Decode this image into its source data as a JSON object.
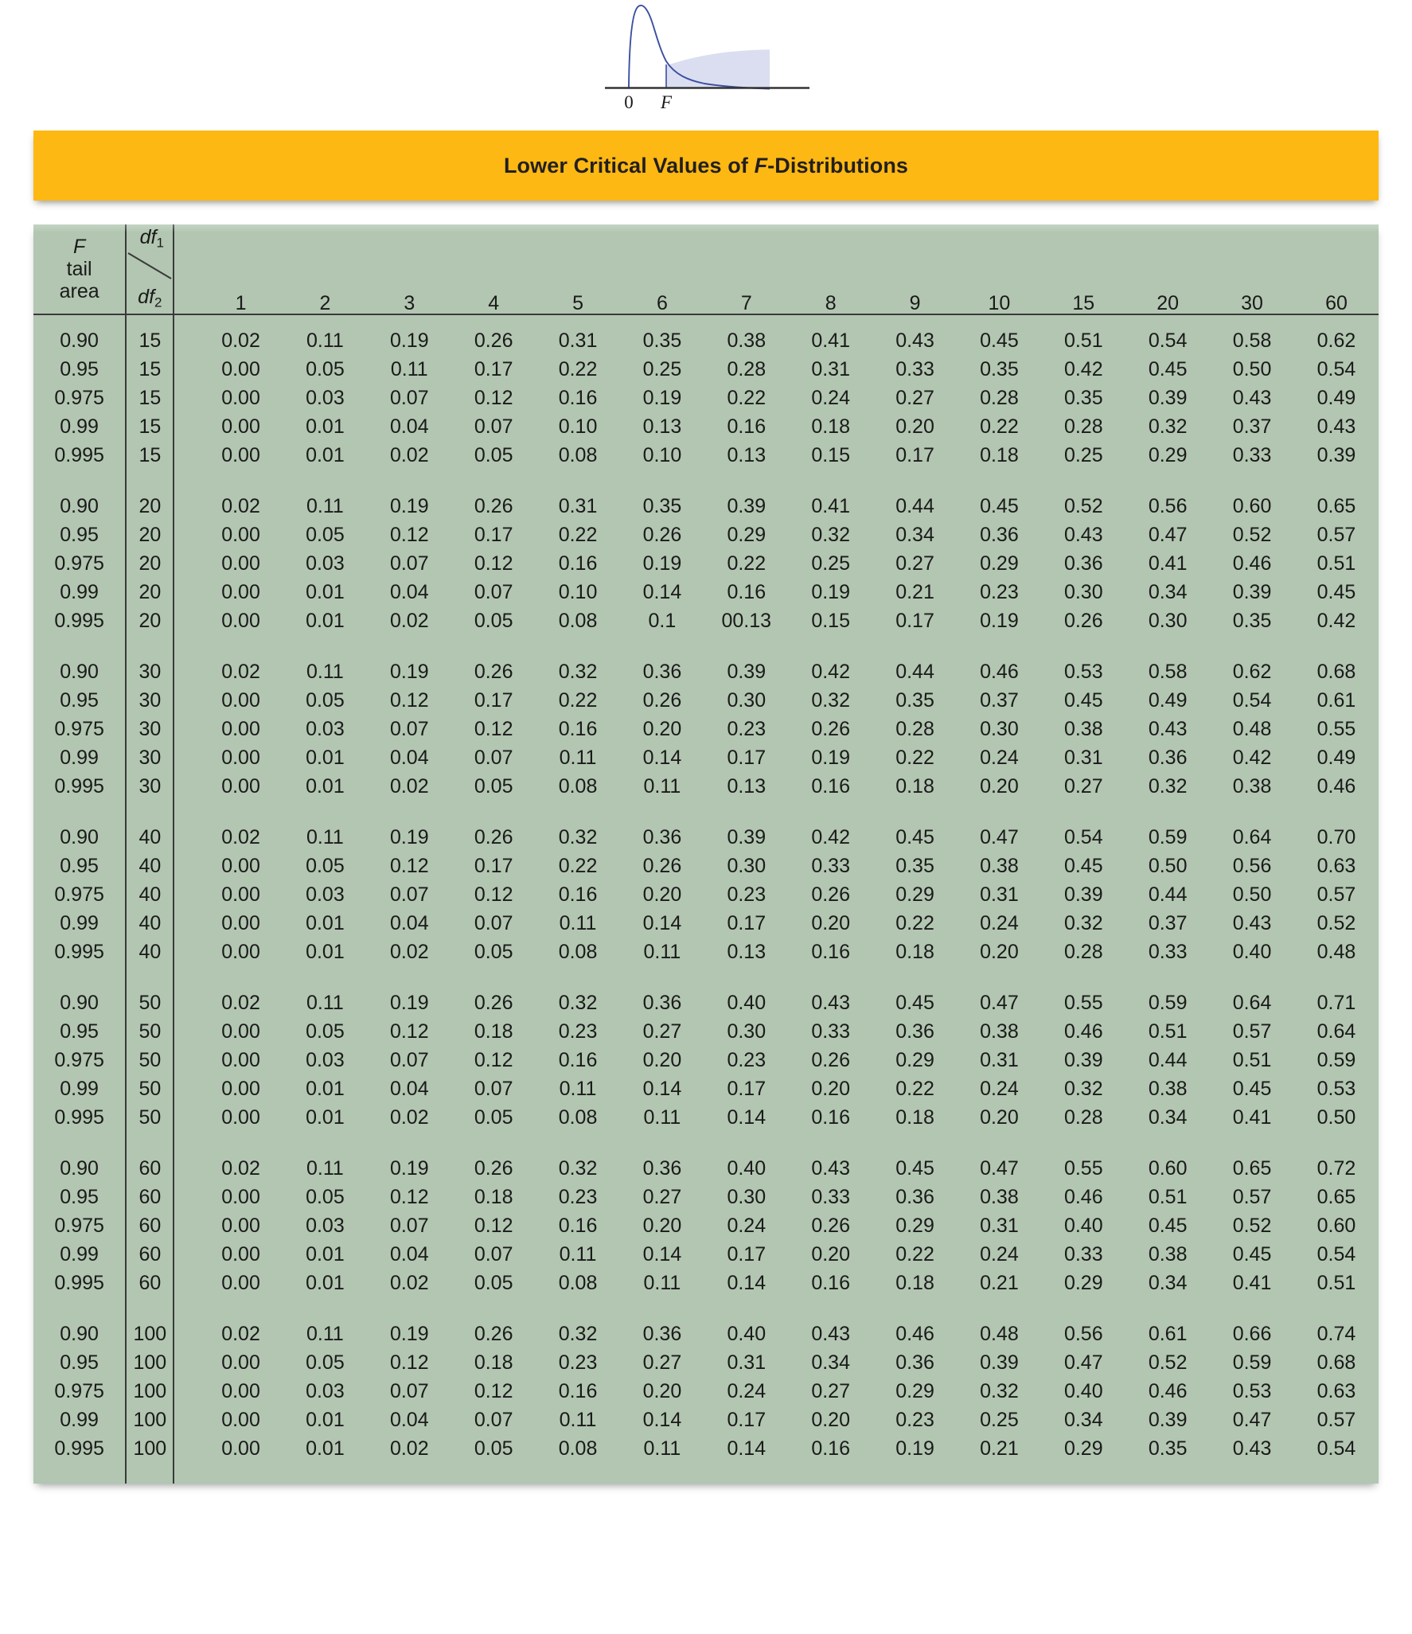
{
  "figure": {
    "axis_label_zero": "0",
    "axis_label_f": "F",
    "curve_color": "#3b4ea0",
    "shade_color": "#d9dcef",
    "axis_color": "#333333",
    "description": "F-distribution density curve with right tail shaded beyond F"
  },
  "title": {
    "prefix": "Lower Critical Values of ",
    "italic": "F",
    "suffix": "-Distributions",
    "full": "Lower Critical Values of F-Distributions",
    "banner_color": "#fdb813"
  },
  "table": {
    "background_color": "#b2c6b1",
    "corner": {
      "tail_label_line1": "F",
      "tail_label_line2": "tail",
      "tail_label_line3": "area",
      "df1": "df",
      "df1_sub": "1",
      "df2": "df",
      "df2_sub": "2"
    },
    "columns": [
      "1",
      "2",
      "3",
      "4",
      "5",
      "6",
      "7",
      "8",
      "9",
      "10",
      "15",
      "20",
      "30",
      "60"
    ],
    "blocks": [
      {
        "df2": "15",
        "rows": [
          {
            "tail": "0.90",
            "df2": "15",
            "values": [
              "0.02",
              "0.11",
              "0.19",
              "0.26",
              "0.31",
              "0.35",
              "0.38",
              "0.41",
              "0.43",
              "0.45",
              "0.51",
              "0.54",
              "0.58",
              "0.62"
            ]
          },
          {
            "tail": "0.95",
            "df2": "15",
            "values": [
              "0.00",
              "0.05",
              "0.11",
              "0.17",
              "0.22",
              "0.25",
              "0.28",
              "0.31",
              "0.33",
              "0.35",
              "0.42",
              "0.45",
              "0.50",
              "0.54"
            ]
          },
          {
            "tail": "0.975",
            "df2": "15",
            "values": [
              "0.00",
              "0.03",
              "0.07",
              "0.12",
              "0.16",
              "0.19",
              "0.22",
              "0.24",
              "0.27",
              "0.28",
              "0.35",
              "0.39",
              "0.43",
              "0.49"
            ]
          },
          {
            "tail": "0.99",
            "df2": "15",
            "values": [
              "0.00",
              "0.01",
              "0.04",
              "0.07",
              "0.10",
              "0.13",
              "0.16",
              "0.18",
              "0.20",
              "0.22",
              "0.28",
              "0.32",
              "0.37",
              "0.43"
            ]
          },
          {
            "tail": "0.995",
            "df2": "15",
            "values": [
              "0.00",
              "0.01",
              "0.02",
              "0.05",
              "0.08",
              "0.10",
              "0.13",
              "0.15",
              "0.17",
              "0.18",
              "0.25",
              "0.29",
              "0.33",
              "0.39"
            ]
          }
        ]
      },
      {
        "df2": "20",
        "rows": [
          {
            "tail": "0.90",
            "df2": "20",
            "values": [
              "0.02",
              "0.11",
              "0.19",
              "0.26",
              "0.31",
              "0.35",
              "0.39",
              "0.41",
              "0.44",
              "0.45",
              "0.52",
              "0.56",
              "0.60",
              "0.65"
            ]
          },
          {
            "tail": "0.95",
            "df2": "20",
            "values": [
              "0.00",
              "0.05",
              "0.12",
              "0.17",
              "0.22",
              "0.26",
              "0.29",
              "0.32",
              "0.34",
              "0.36",
              "0.43",
              "0.47",
              "0.52",
              "0.57"
            ]
          },
          {
            "tail": "0.975",
            "df2": "20",
            "values": [
              "0.00",
              "0.03",
              "0.07",
              "0.12",
              "0.16",
              "0.19",
              "0.22",
              "0.25",
              "0.27",
              "0.29",
              "0.36",
              "0.41",
              "0.46",
              "0.51"
            ]
          },
          {
            "tail": "0.99",
            "df2": "20",
            "values": [
              "0.00",
              "0.01",
              "0.04",
              "0.07",
              "0.10",
              "0.14",
              "0.16",
              "0.19",
              "0.21",
              "0.23",
              "0.30",
              "0.34",
              "0.39",
              "0.45"
            ]
          },
          {
            "tail": "0.995",
            "df2": "20",
            "values": [
              "0.00",
              "0.01",
              "0.02",
              "0.05",
              "0.08",
              "0.1",
              "00.13",
              "0.15",
              "0.17",
              "0.19",
              "0.26",
              "0.30",
              "0.35",
              "0.42"
            ]
          }
        ]
      },
      {
        "df2": "30",
        "rows": [
          {
            "tail": "0.90",
            "df2": "30",
            "values": [
              "0.02",
              "0.11",
              "0.19",
              "0.26",
              "0.32",
              "0.36",
              "0.39",
              "0.42",
              "0.44",
              "0.46",
              "0.53",
              "0.58",
              "0.62",
              "0.68"
            ]
          },
          {
            "tail": "0.95",
            "df2": "30",
            "values": [
              "0.00",
              "0.05",
              "0.12",
              "0.17",
              "0.22",
              "0.26",
              "0.30",
              "0.32",
              "0.35",
              "0.37",
              "0.45",
              "0.49",
              "0.54",
              "0.61"
            ]
          },
          {
            "tail": "0.975",
            "df2": "30",
            "values": [
              "0.00",
              "0.03",
              "0.07",
              "0.12",
              "0.16",
              "0.20",
              "0.23",
              "0.26",
              "0.28",
              "0.30",
              "0.38",
              "0.43",
              "0.48",
              "0.55"
            ]
          },
          {
            "tail": "0.99",
            "df2": "30",
            "values": [
              "0.00",
              "0.01",
              "0.04",
              "0.07",
              "0.11",
              "0.14",
              "0.17",
              "0.19",
              "0.22",
              "0.24",
              "0.31",
              "0.36",
              "0.42",
              "0.49"
            ]
          },
          {
            "tail": "0.995",
            "df2": "30",
            "values": [
              "0.00",
              "0.01",
              "0.02",
              "0.05",
              "0.08",
              "0.11",
              "0.13",
              "0.16",
              "0.18",
              "0.20",
              "0.27",
              "0.32",
              "0.38",
              "0.46"
            ]
          }
        ]
      },
      {
        "df2": "40",
        "rows": [
          {
            "tail": "0.90",
            "df2": "40",
            "values": [
              "0.02",
              "0.11",
              "0.19",
              "0.26",
              "0.32",
              "0.36",
              "0.39",
              "0.42",
              "0.45",
              "0.47",
              "0.54",
              "0.59",
              "0.64",
              "0.70"
            ]
          },
          {
            "tail": "0.95",
            "df2": "40",
            "values": [
              "0.00",
              "0.05",
              "0.12",
              "0.17",
              "0.22",
              "0.26",
              "0.30",
              "0.33",
              "0.35",
              "0.38",
              "0.45",
              "0.50",
              "0.56",
              "0.63"
            ]
          },
          {
            "tail": "0.975",
            "df2": "40",
            "values": [
              "0.00",
              "0.03",
              "0.07",
              "0.12",
              "0.16",
              "0.20",
              "0.23",
              "0.26",
              "0.29",
              "0.31",
              "0.39",
              "0.44",
              "0.50",
              "0.57"
            ]
          },
          {
            "tail": "0.99",
            "df2": "40",
            "values": [
              "0.00",
              "0.01",
              "0.04",
              "0.07",
              "0.11",
              "0.14",
              "0.17",
              "0.20",
              "0.22",
              "0.24",
              "0.32",
              "0.37",
              "0.43",
              "0.52"
            ]
          },
          {
            "tail": "0.995",
            "df2": "40",
            "values": [
              "0.00",
              "0.01",
              "0.02",
              "0.05",
              "0.08",
              "0.11",
              "0.13",
              "0.16",
              "0.18",
              "0.20",
              "0.28",
              "0.33",
              "0.40",
              "0.48"
            ]
          }
        ]
      },
      {
        "df2": "50",
        "rows": [
          {
            "tail": "0.90",
            "df2": "50",
            "values": [
              "0.02",
              "0.11",
              "0.19",
              "0.26",
              "0.32",
              "0.36",
              "0.40",
              "0.43",
              "0.45",
              "0.47",
              "0.55",
              "0.59",
              "0.64",
              "0.71"
            ]
          },
          {
            "tail": "0.95",
            "df2": "50",
            "values": [
              "0.00",
              "0.05",
              "0.12",
              "0.18",
              "0.23",
              "0.27",
              "0.30",
              "0.33",
              "0.36",
              "0.38",
              "0.46",
              "0.51",
              "0.57",
              "0.64"
            ]
          },
          {
            "tail": "0.975",
            "df2": "50",
            "values": [
              "0.00",
              "0.03",
              "0.07",
              "0.12",
              "0.16",
              "0.20",
              "0.23",
              "0.26",
              "0.29",
              "0.31",
              "0.39",
              "0.44",
              "0.51",
              "0.59"
            ]
          },
          {
            "tail": "0.99",
            "df2": "50",
            "values": [
              "0.00",
              "0.01",
              "0.04",
              "0.07",
              "0.11",
              "0.14",
              "0.17",
              "0.20",
              "0.22",
              "0.24",
              "0.32",
              "0.38",
              "0.45",
              "0.53"
            ]
          },
          {
            "tail": "0.995",
            "df2": "50",
            "values": [
              "0.00",
              "0.01",
              "0.02",
              "0.05",
              "0.08",
              "0.11",
              "0.14",
              "0.16",
              "0.18",
              "0.20",
              "0.28",
              "0.34",
              "0.41",
              "0.50"
            ]
          }
        ]
      },
      {
        "df2": "60",
        "rows": [
          {
            "tail": "0.90",
            "df2": "60",
            "values": [
              "0.02",
              "0.11",
              "0.19",
              "0.26",
              "0.32",
              "0.36",
              "0.40",
              "0.43",
              "0.45",
              "0.47",
              "0.55",
              "0.60",
              "0.65",
              "0.72"
            ]
          },
          {
            "tail": "0.95",
            "df2": "60",
            "values": [
              "0.00",
              "0.05",
              "0.12",
              "0.18",
              "0.23",
              "0.27",
              "0.30",
              "0.33",
              "0.36",
              "0.38",
              "0.46",
              "0.51",
              "0.57",
              "0.65"
            ]
          },
          {
            "tail": "0.975",
            "df2": "60",
            "values": [
              "0.00",
              "0.03",
              "0.07",
              "0.12",
              "0.16",
              "0.20",
              "0.24",
              "0.26",
              "0.29",
              "0.31",
              "0.40",
              "0.45",
              "0.52",
              "0.60"
            ]
          },
          {
            "tail": "0.99",
            "df2": "60",
            "values": [
              "0.00",
              "0.01",
              "0.04",
              "0.07",
              "0.11",
              "0.14",
              "0.17",
              "0.20",
              "0.22",
              "0.24",
              "0.33",
              "0.38",
              "0.45",
              "0.54"
            ]
          },
          {
            "tail": "0.995",
            "df2": "60",
            "values": [
              "0.00",
              "0.01",
              "0.02",
              "0.05",
              "0.08",
              "0.11",
              "0.14",
              "0.16",
              "0.18",
              "0.21",
              "0.29",
              "0.34",
              "0.41",
              "0.51"
            ]
          }
        ]
      },
      {
        "df2": "100",
        "rows": [
          {
            "tail": "0.90",
            "df2": "100",
            "values": [
              "0.02",
              "0.11",
              "0.19",
              "0.26",
              "0.32",
              "0.36",
              "0.40",
              "0.43",
              "0.46",
              "0.48",
              "0.56",
              "0.61",
              "0.66",
              "0.74"
            ]
          },
          {
            "tail": "0.95",
            "df2": "100",
            "values": [
              "0.00",
              "0.05",
              "0.12",
              "0.18",
              "0.23",
              "0.27",
              "0.31",
              "0.34",
              "0.36",
              "0.39",
              "0.47",
              "0.52",
              "0.59",
              "0.68"
            ]
          },
          {
            "tail": "0.975",
            "df2": "100",
            "values": [
              "0.00",
              "0.03",
              "0.07",
              "0.12",
              "0.16",
              "0.20",
              "0.24",
              "0.27",
              "0.29",
              "0.32",
              "0.40",
              "0.46",
              "0.53",
              "0.63"
            ]
          },
          {
            "tail": "0.99",
            "df2": "100",
            "values": [
              "0.00",
              "0.01",
              "0.04",
              "0.07",
              "0.11",
              "0.14",
              "0.17",
              "0.20",
              "0.23",
              "0.25",
              "0.34",
              "0.39",
              "0.47",
              "0.57"
            ]
          },
          {
            "tail": "0.995",
            "df2": "100",
            "values": [
              "0.00",
              "0.01",
              "0.02",
              "0.05",
              "0.08",
              "0.11",
              "0.14",
              "0.16",
              "0.19",
              "0.21",
              "0.29",
              "0.35",
              "0.43",
              "0.54"
            ]
          }
        ]
      }
    ]
  }
}
